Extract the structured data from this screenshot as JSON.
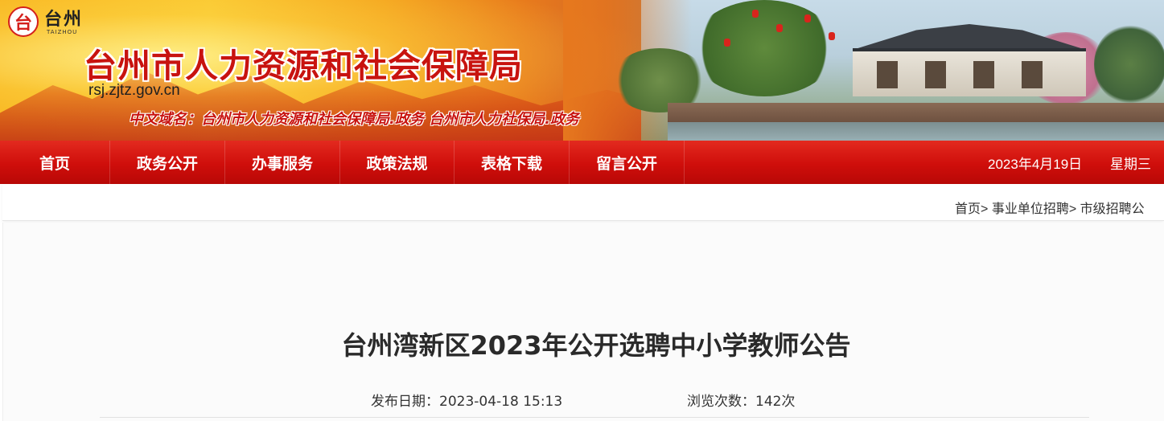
{
  "header": {
    "logo_glyph": "台",
    "logo_text": "台州",
    "logo_sub": "TAIZHOU",
    "site_title": "台州市人力资源和社会保障局",
    "site_url": "rsj.zjtz.gov.cn",
    "domain_line": "中文域名：台州市人力资源和社会保障局.政务 台州市人力社保局.政务"
  },
  "nav": {
    "items": [
      {
        "label": "首页"
      },
      {
        "label": "政务公开"
      },
      {
        "label": "办事服务"
      },
      {
        "label": "政策法规"
      },
      {
        "label": "表格下载"
      },
      {
        "label": "留言公开"
      }
    ],
    "date": "2023年4月19日",
    "weekday": "星期三"
  },
  "breadcrumb": {
    "items": [
      "首页",
      "事业单位招聘",
      "市级招聘公"
    ],
    "separator": ">"
  },
  "article": {
    "title": "台州湾新区2023年公开选聘中小学教师公告",
    "publish_label": "发布日期：",
    "publish_date": "2023-04-18 15:13",
    "views_label": "浏览次数：",
    "views_count": "142次"
  },
  "colors": {
    "nav_red": "#cf0e0b",
    "title_red": "#c8130f"
  }
}
